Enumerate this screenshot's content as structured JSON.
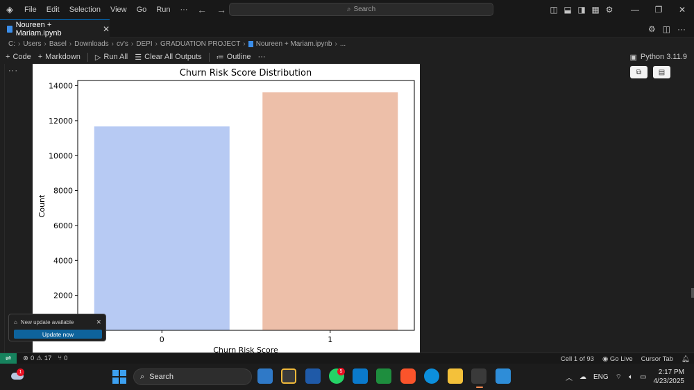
{
  "window": {
    "menu": [
      "File",
      "Edit",
      "Selection",
      "View",
      "Go",
      "Run",
      "···"
    ],
    "search_placeholder": "Search"
  },
  "tab": {
    "label": "Noureen + Mariam.ipynb",
    "close": "✕"
  },
  "breadcrumb": [
    "C:",
    "Users",
    "Basel",
    "Downloads",
    "cv's",
    "DEPI",
    "GRADUATION PROJECT",
    "Noureen + Mariam.ipynb",
    "..."
  ],
  "toolbar": {
    "code": "Code",
    "markdown": "Markdown",
    "run_all": "Run All",
    "clear_outputs": "Clear All Outputs",
    "outline": "Outline",
    "more": "···",
    "kernel": "Python 3.11.9"
  },
  "cell": {
    "dots": "···"
  },
  "chart_data": {
    "type": "bar",
    "title": "Churn Risk Score Distribution",
    "xlabel": "Churn Risk Score",
    "ylabel": "Count",
    "categories": [
      "0",
      "1"
    ],
    "values": [
      11650,
      13600
    ],
    "colors": [
      "#b7caf3",
      "#edbfa9"
    ],
    "yticks": [
      2000,
      4000,
      6000,
      8000,
      10000,
      12000,
      14000
    ],
    "ylim": [
      0,
      14300
    ],
    "legend": "none",
    "grid": false
  },
  "toast": {
    "title": "New update available",
    "button": "Update now",
    "close": "✕"
  },
  "statusbar": {
    "errors": "0",
    "warnings": "17",
    "ports": "0",
    "cell_position": "Cell 1 of 93",
    "go_live": "Go Live",
    "cursor_tab": "Cursor Tab"
  },
  "taskbar": {
    "search": "Search",
    "whatsapp_badge": "5",
    "weather_badge": "1",
    "language": "ENG",
    "time": "2:17 PM",
    "date": "4/23/2025"
  }
}
